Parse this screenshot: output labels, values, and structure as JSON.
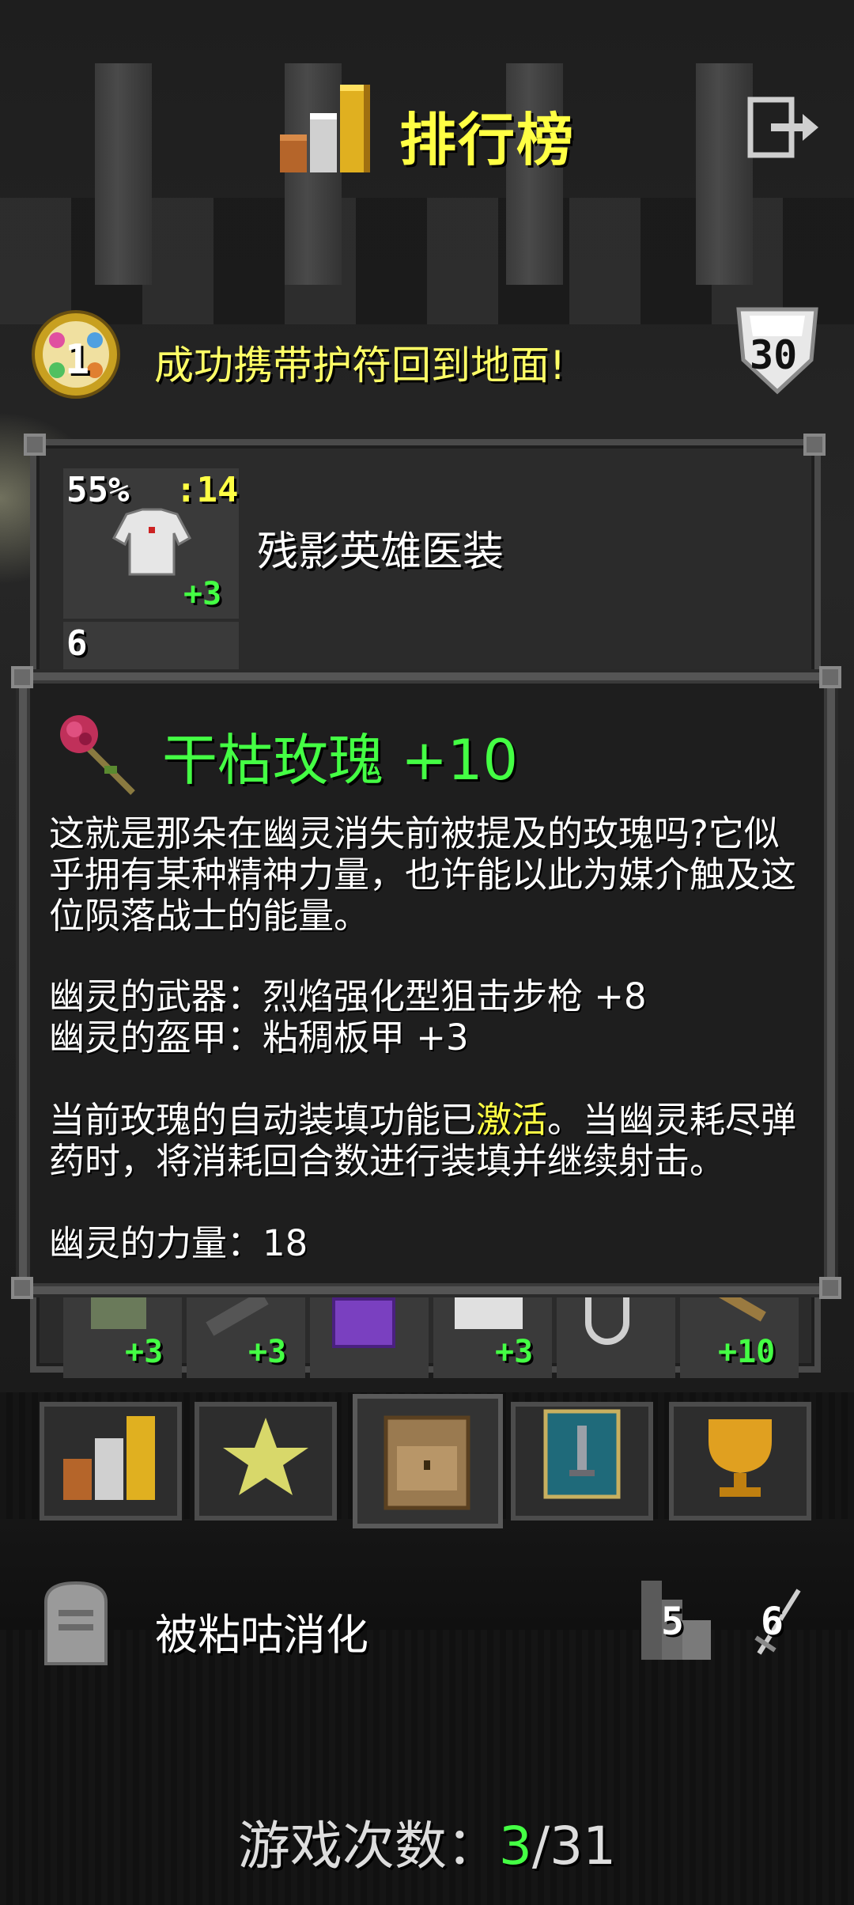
{
  "header": {
    "title": "排行榜",
    "exit_icon": "exit-icon"
  },
  "badge": {
    "medal_number": "1",
    "text": "成功携带护符回到地面!",
    "depth_number": "30"
  },
  "record": {
    "armor": {
      "percent": "55%",
      "level": ":14",
      "upgrade": "+3",
      "name": "残影英雄医装"
    },
    "second_slot_number": "6"
  },
  "tooltip": {
    "item_name": "干枯玫瑰",
    "item_level": "+10",
    "description": "这就是那朵在幽灵消失前被提及的玫瑰吗?它似乎拥有某种精神力量，也许能以此为媒介触及这位陨落战士的能量。",
    "weapon_line": "幽灵的武器：烈焰强化型狙击步枪 +8",
    "armor_line": "幽灵的盔甲：粘稠板甲 +3",
    "reload_before": "当前玫瑰的自动装填功能已",
    "reload_highlight": "激活",
    "reload_after": "。当幽灵耗尽弹药时，将消耗回合数进行装填并继续射击。",
    "strength_line": "幽灵的力量：18"
  },
  "equip_row": [
    {
      "icon": "boots-icon",
      "bonus": "+3"
    },
    {
      "icon": "gun-icon",
      "bonus": "+3"
    },
    {
      "icon": "spellbook-icon",
      "bonus": ""
    },
    {
      "icon": "armor-icon",
      "bonus": "+3"
    },
    {
      "icon": "ring-icon",
      "bonus": ""
    },
    {
      "icon": "rose-icon",
      "bonus": "+10"
    }
  ],
  "tabs": [
    "stats-tab-icon",
    "badges-tab-icon",
    "backpack-tab-icon",
    "item-tab-icon",
    "trophy-tab-icon"
  ],
  "death": {
    "cause": "被粘咕消化",
    "depth": "5",
    "level": "6"
  },
  "games": {
    "label": "游戏次数：",
    "current": "3",
    "separator": "/",
    "total": "31"
  },
  "colors": {
    "title": "#ffff44",
    "highlight": "#ffff44",
    "positive": "#44ff44"
  }
}
